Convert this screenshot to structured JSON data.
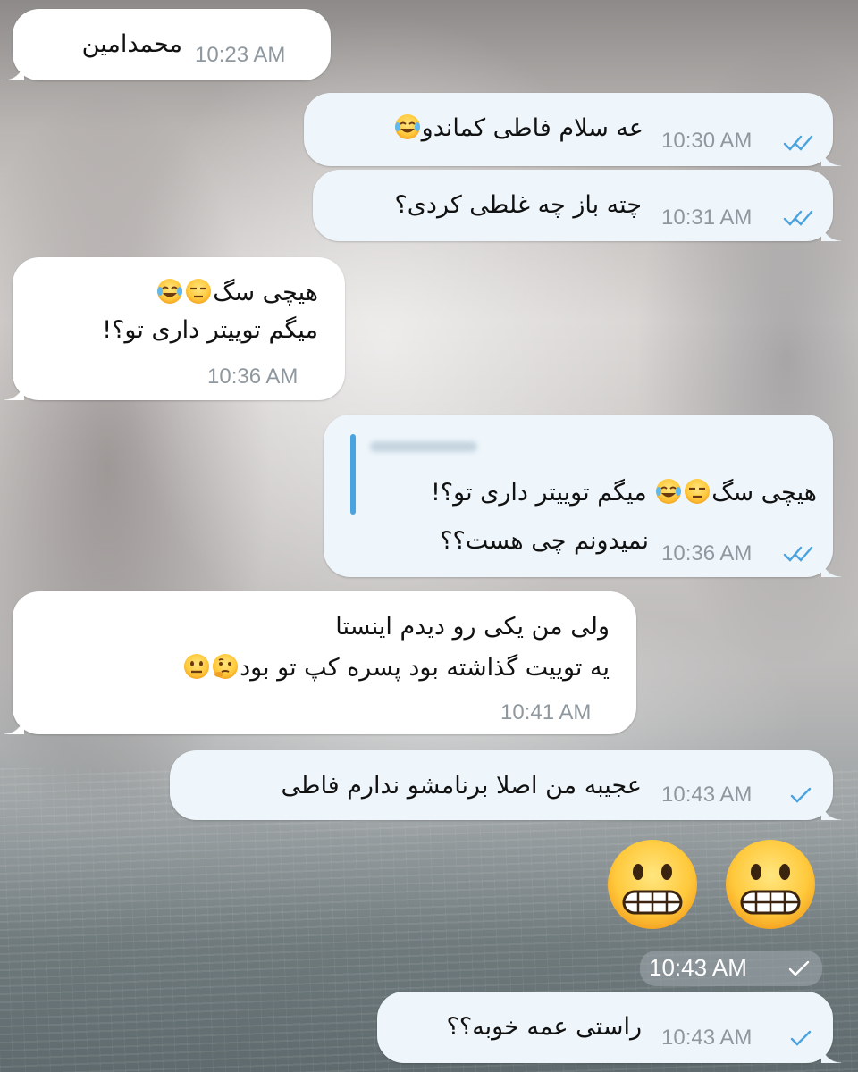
{
  "colors": {
    "incoming_bubble": "#ffffff",
    "outgoing_bubble": "#eef6fb",
    "read_check": "#4aa3df",
    "reply_bar": "#4aa3df",
    "timestamp": "#8f989e"
  },
  "messages": [
    {
      "direction": "incoming",
      "text_lines": [
        "محمدامین"
      ],
      "time": "10:23 AM"
    },
    {
      "direction": "outgoing",
      "text_lines": [
        "عه سلام فاطی کماندو😂"
      ],
      "time": "10:30 AM",
      "status_icon": "double-check-icon"
    },
    {
      "direction": "outgoing",
      "text_lines": [
        "چته باز چه غلطی کردی؟"
      ],
      "time": "10:31 AM",
      "status_icon": "double-check-icon"
    },
    {
      "direction": "incoming",
      "text_lines": [
        "هیچی سگ😒😂",
        "میگم توییتر داری تو؟!"
      ],
      "time": "10:36 AM"
    },
    {
      "direction": "outgoing",
      "reply_quote": "هیچی سگ😒😂 میگم توییتر داری تو؟!",
      "text_lines": [
        "نمیدونم چی هست؟؟"
      ],
      "time": "10:36 AM",
      "status_icon": "double-check-icon"
    },
    {
      "direction": "incoming",
      "text_lines": [
        "ولی من یکی رو دیدم اینستا",
        "یه توییت گذاشته بود پسره کپ تو بود🤔😐"
      ],
      "time": "10:41 AM"
    },
    {
      "direction": "outgoing",
      "text_lines": [
        "عجیبه من اصلا برنامشو ندارم فاطی"
      ],
      "time": "10:43 AM",
      "status_icon": "single-check-icon"
    },
    {
      "direction": "outgoing",
      "sticker": [
        "grimacing-face-icon",
        "grimacing-face-icon"
      ],
      "time": "10:43 AM",
      "status_icon": "single-check-icon"
    },
    {
      "direction": "outgoing",
      "text_lines": [
        "راستی عمه خوبه؟؟"
      ],
      "time": "10:43 AM",
      "status_icon": "single-check-icon"
    }
  ]
}
